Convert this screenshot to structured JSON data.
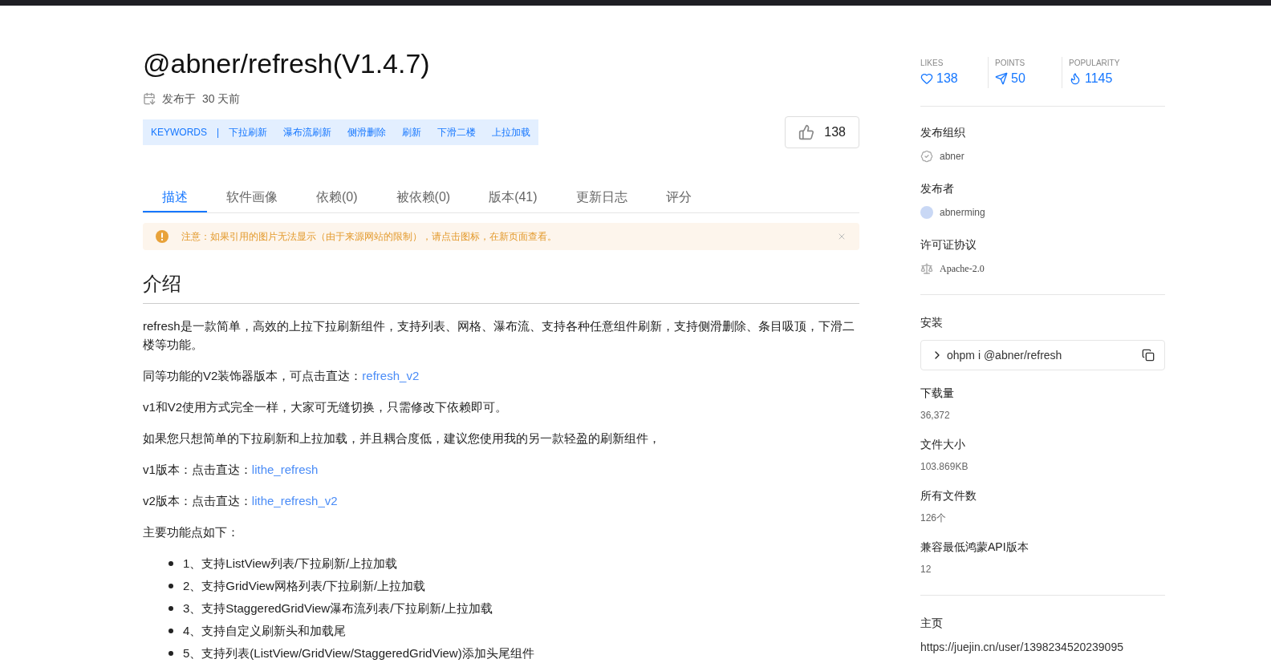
{
  "title": "@abner/refresh(V1.4.7)",
  "published": {
    "label": "发布于",
    "time": "30 天前"
  },
  "keywords": {
    "label": "KEYWORDS",
    "separator": "|",
    "items": [
      "下拉刷新",
      "瀑布流刷新",
      "侧滑删除",
      "刷新",
      "下滑二楼",
      "上拉加载"
    ]
  },
  "like_button": {
    "count": "138"
  },
  "tabs": [
    {
      "label": "描述",
      "selected": true
    },
    {
      "label": "软件画像",
      "selected": false
    },
    {
      "label": "依赖(0)",
      "selected": false
    },
    {
      "label": "被依赖(0)",
      "selected": false
    },
    {
      "label": "版本(41)",
      "selected": false
    },
    {
      "label": "更新日志",
      "selected": false
    },
    {
      "label": "评分",
      "selected": false
    }
  ],
  "notice": {
    "text": "注意：如果引用的图片无法显示（由于来源网站的限制），请点击图标，在新页面查看。"
  },
  "section_heading": "介绍",
  "paragraphs": [
    {
      "text": "refresh是一款简单，高效的上拉下拉刷新组件，支持列表、网格、瀑布流、支持各种任意组件刷新，支持侧滑删除、条目吸顶，下滑二楼等功能。"
    },
    {
      "text": "同等功能的V2装饰器版本，可点击直达：",
      "link": "refresh_v2"
    },
    {
      "text": "v1和V2使用方式完全一样，大家可无缝切换，只需修改下依赖即可。"
    },
    {
      "text": "如果您只想简单的下拉刷新和上拉加载，并且耦合度低，建议您使用我的另一款轻盈的刷新组件，"
    },
    {
      "text": "v1版本：点击直达：",
      "link": "lithe_refresh"
    },
    {
      "text": "v2版本：点击直达：",
      "link": "lithe_refresh_v2"
    },
    {
      "text": "主要功能点如下："
    }
  ],
  "features": [
    "1、支持ListView列表/下拉刷新/上拉加载",
    "2、支持GridView网格列表/下拉刷新/上拉加载",
    "3、支持StaggeredGridView瀑布流列表/下拉刷新/上拉加载",
    "4、支持自定义刷新头和加载尾",
    "5、支持列表(ListView/GridView/StaggeredGridView)添加头尾组件"
  ],
  "stats": [
    {
      "kind": "likes",
      "label": "LIKES",
      "value": "138"
    },
    {
      "kind": "points",
      "label": "POINTS",
      "value": "50"
    },
    {
      "kind": "popularity",
      "label": "POPULARITY",
      "value": "1145"
    }
  ],
  "publisher_org": {
    "heading": "发布组织",
    "name": "abner"
  },
  "publisher": {
    "heading": "发布者",
    "name": "abnerming"
  },
  "license": {
    "heading": "许可证协议",
    "name": "Apache-2.0"
  },
  "install": {
    "heading": "安装",
    "command": "ohpm i @abner/refresh"
  },
  "details": [
    {
      "heading": "下载量",
      "value": "36,372"
    },
    {
      "heading": "文件大小",
      "value": "103.869KB"
    },
    {
      "heading": "所有文件数",
      "value": "126个"
    },
    {
      "heading": "兼容最低鸿蒙API版本",
      "value": "12"
    }
  ],
  "homepage": {
    "heading": "主页",
    "url": "https://juejin.cn/user/1398234520239095"
  }
}
